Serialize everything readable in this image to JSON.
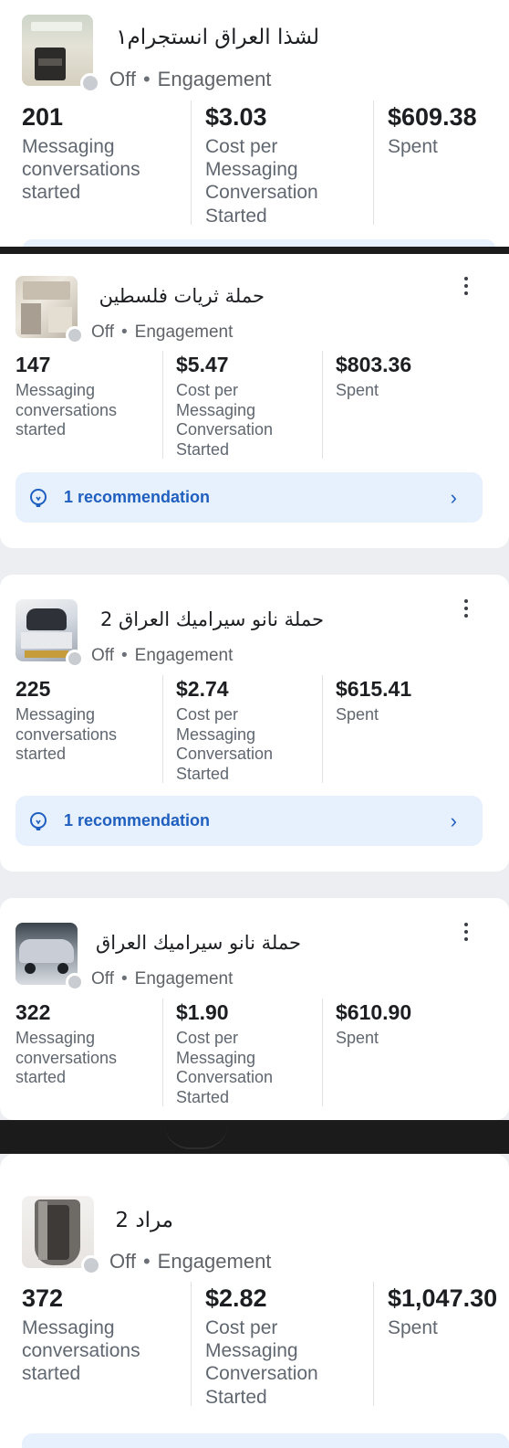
{
  "campaigns": [
    {
      "title": "لشذا العراق انستجرام١",
      "status": "Off",
      "objective": "Engagement",
      "metric1_value": "201",
      "metric1_label": "Messaging conversations started",
      "metric2_value": "$3.03",
      "metric2_label": "Cost per Messaging Conversation Started",
      "metric3_value": "$609.38",
      "metric3_label": "Spent"
    },
    {
      "title": "حملة ثريات فلسطين",
      "status": "Off",
      "objective": "Engagement",
      "metric1_value": "147",
      "metric1_label": "Messaging conversations started",
      "metric2_value": "$5.47",
      "metric2_label": "Cost per Messaging Conversation Started",
      "metric3_value": "$803.36",
      "metric3_label": "Spent",
      "recommendation": "1 recommendation"
    },
    {
      "title": "حملة نانو سيراميك العراق 2",
      "status": "Off",
      "objective": "Engagement",
      "metric1_value": "225",
      "metric1_label": "Messaging conversations started",
      "metric2_value": "$2.74",
      "metric2_label": "Cost per Messaging Conversation Started",
      "metric3_value": "$615.41",
      "metric3_label": "Spent",
      "recommendation": "1 recommendation"
    },
    {
      "title": "حملة نانو سيراميك العراق",
      "status": "Off",
      "objective": "Engagement",
      "metric1_value": "322",
      "metric1_label": "Messaging conversations started",
      "metric2_value": "$1.90",
      "metric2_label": "Cost per Messaging Conversation Started",
      "metric3_value": "$610.90",
      "metric3_label": "Spent"
    },
    {
      "title": "مراد 2",
      "status": "Off",
      "objective": "Engagement",
      "metric1_value": "372",
      "metric1_label": "Messaging conversations started",
      "metric2_value": "$2.82",
      "metric2_label": "Cost per Messaging Conversation Started",
      "metric3_value": "$1,047.30",
      "metric3_label": "Spent"
    }
  ],
  "colors": {
    "recommendation_bg": "#e7f0fd",
    "recommendation_text": "#1f5fbf",
    "status_dot": "#c9ccd1"
  },
  "icons": {
    "recommendation": "lightbulb-icon",
    "more": "more-vertical-icon",
    "chevron": "chevron-right-icon"
  }
}
